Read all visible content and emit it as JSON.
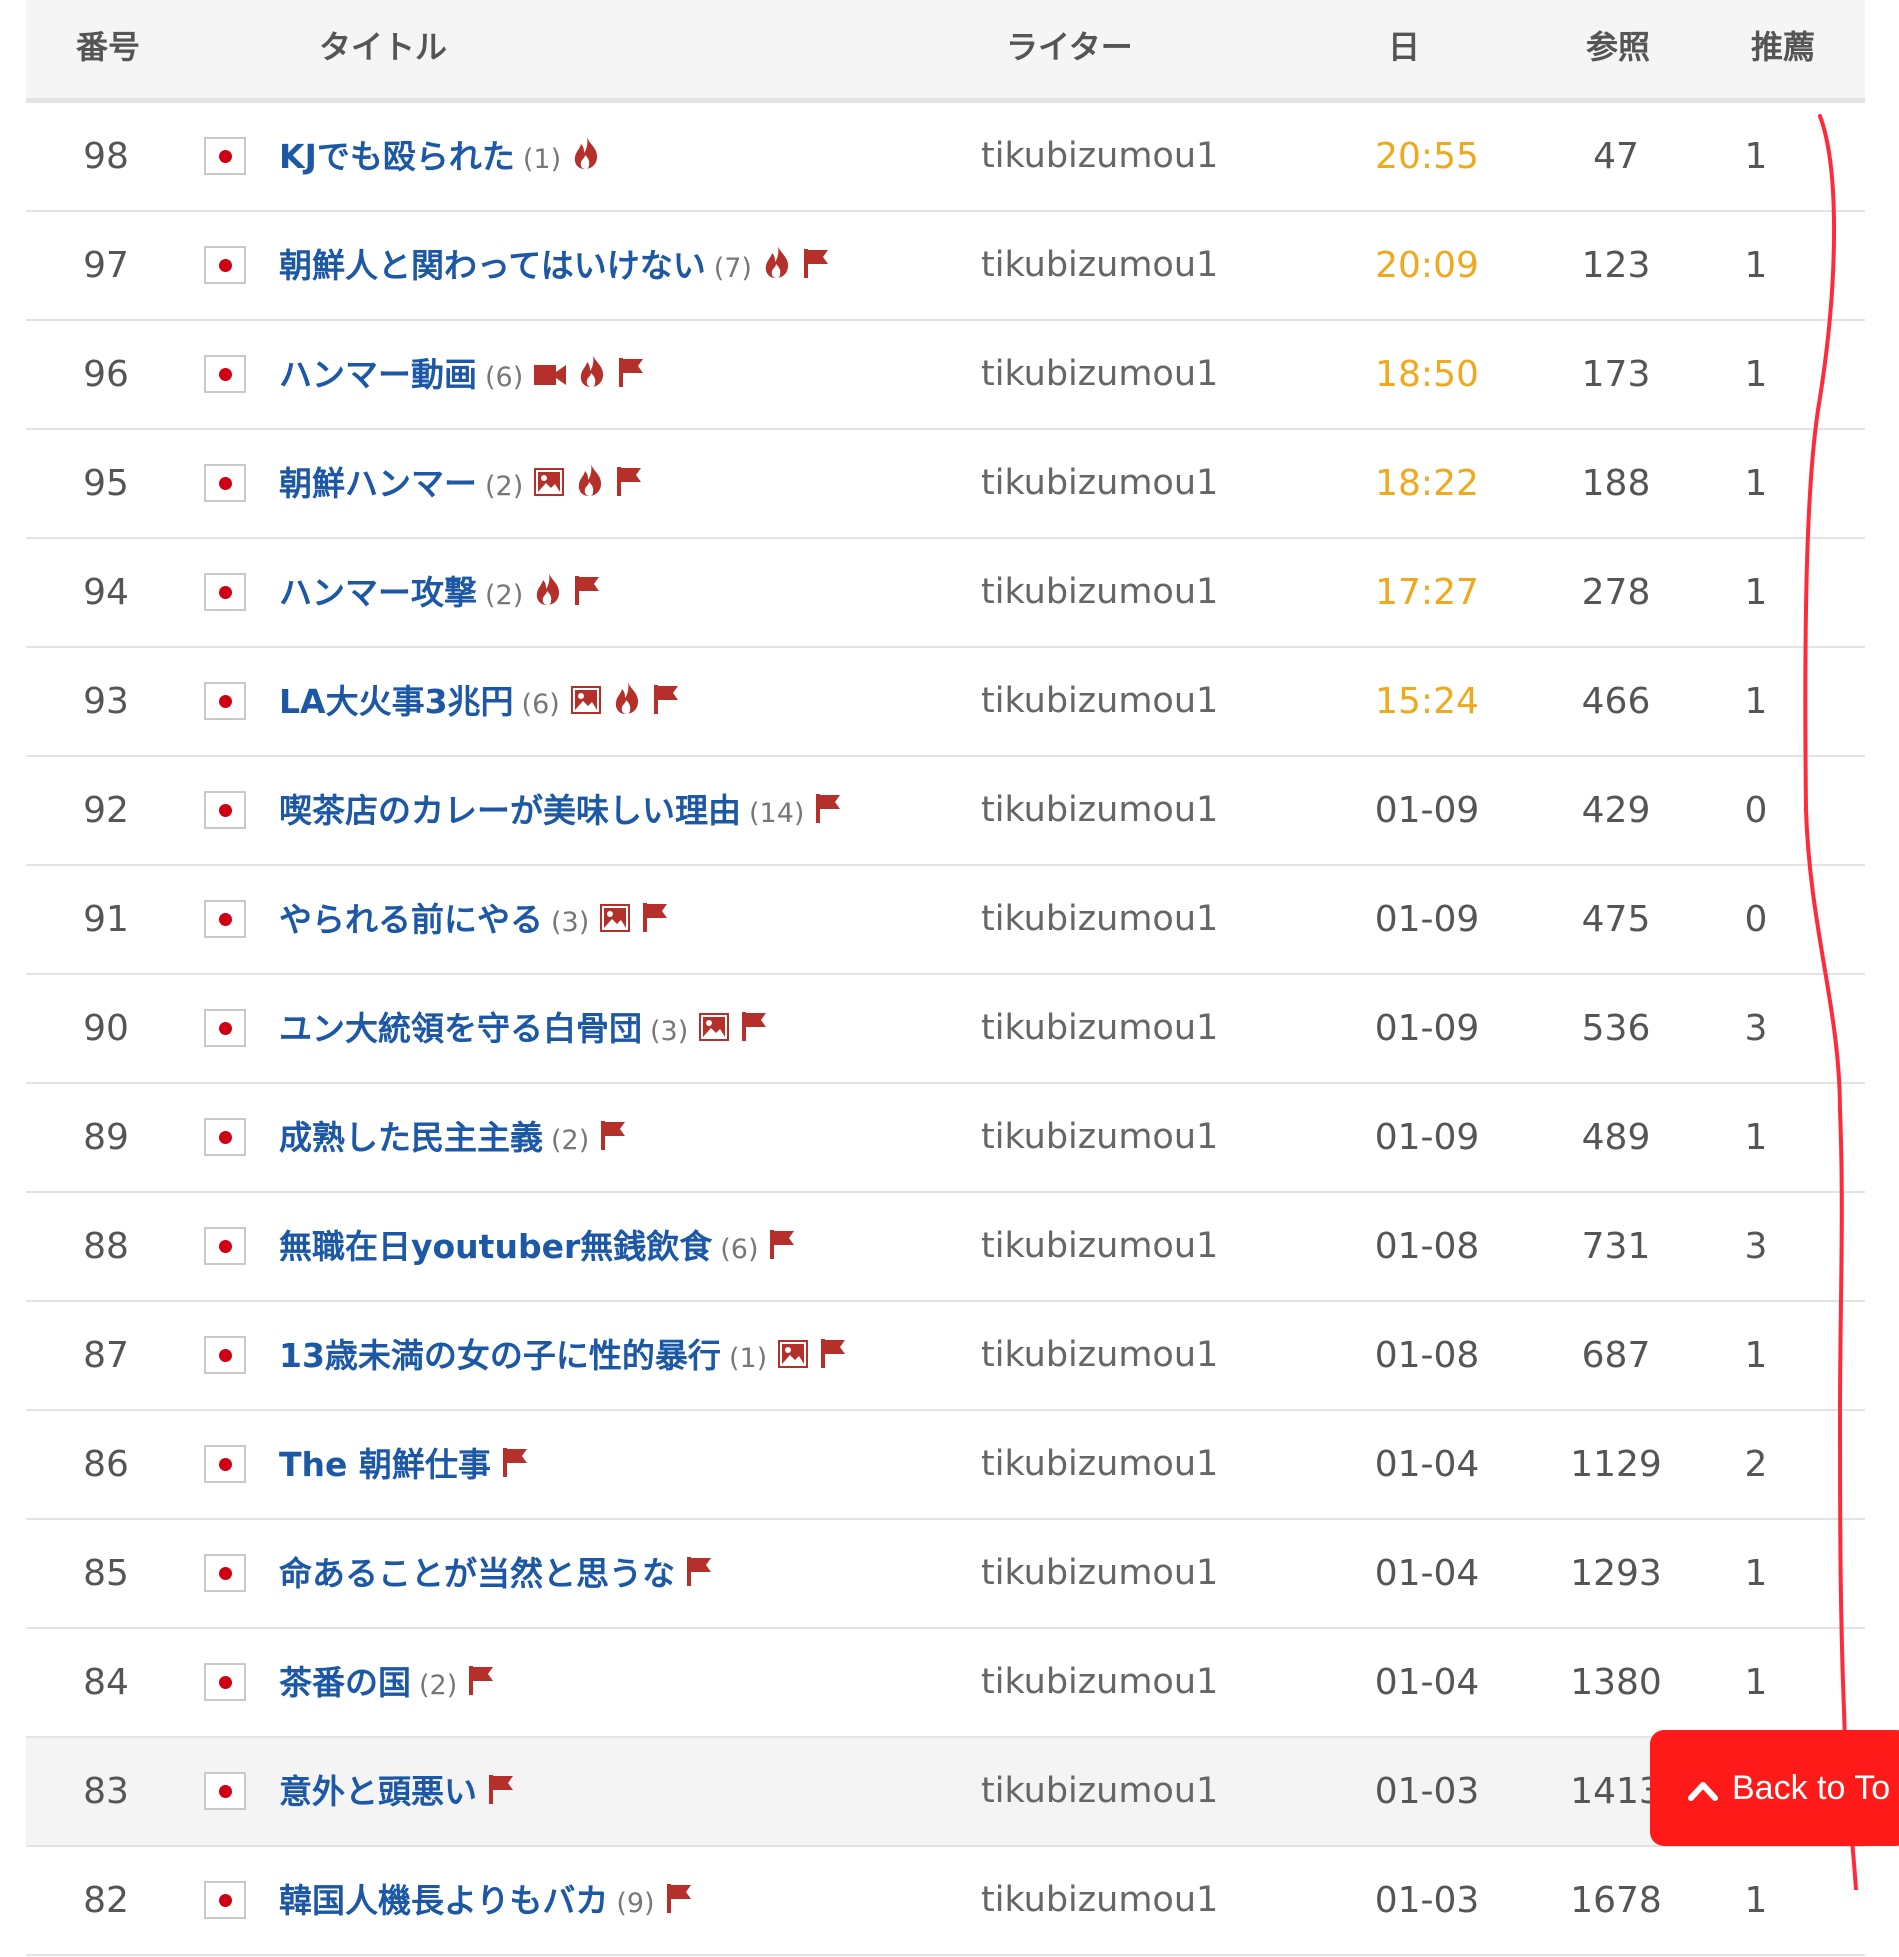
{
  "header": {
    "num": "番号",
    "title": "タイトル",
    "writer": "ライター",
    "date": "日",
    "views": "参照",
    "recommend": "推薦"
  },
  "rows": [
    {
      "num": "98",
      "title": "KJでも殴られた",
      "count": "(1)",
      "icons": [
        "fire"
      ],
      "writer": "tikubizumou1",
      "date": "20:55",
      "today": true,
      "views": "47",
      "rec": "1"
    },
    {
      "num": "97",
      "title": "朝鮮人と関わってはいけない",
      "count": "(7)",
      "icons": [
        "fire",
        "flag"
      ],
      "writer": "tikubizumou1",
      "date": "20:09",
      "today": true,
      "views": "123",
      "rec": "1"
    },
    {
      "num": "96",
      "title": "ハンマー動画",
      "count": "(6)",
      "icons": [
        "video",
        "fire",
        "flag"
      ],
      "writer": "tikubizumou1",
      "date": "18:50",
      "today": true,
      "views": "173",
      "rec": "1"
    },
    {
      "num": "95",
      "title": "朝鮮ハンマー",
      "count": "(2)",
      "icons": [
        "image",
        "fire",
        "flag"
      ],
      "writer": "tikubizumou1",
      "date": "18:22",
      "today": true,
      "views": "188",
      "rec": "1"
    },
    {
      "num": "94",
      "title": "ハンマー攻撃",
      "count": "(2)",
      "icons": [
        "fire",
        "flag"
      ],
      "writer": "tikubizumou1",
      "date": "17:27",
      "today": true,
      "views": "278",
      "rec": "1"
    },
    {
      "num": "93",
      "title": "LA大火事3兆円",
      "count": "(6)",
      "icons": [
        "image",
        "fire",
        "flag"
      ],
      "writer": "tikubizumou1",
      "date": "15:24",
      "today": true,
      "views": "466",
      "rec": "1"
    },
    {
      "num": "92",
      "title": "喫茶店のカレーが美味しい理由",
      "count": "(14)",
      "icons": [
        "flag"
      ],
      "writer": "tikubizumou1",
      "date": "01-09",
      "today": false,
      "views": "429",
      "rec": "0"
    },
    {
      "num": "91",
      "title": "やられる前にやる",
      "count": "(3)",
      "icons": [
        "image",
        "flag"
      ],
      "writer": "tikubizumou1",
      "date": "01-09",
      "today": false,
      "views": "475",
      "rec": "0"
    },
    {
      "num": "90",
      "title": "ユン大統領を守る白骨団",
      "count": "(3)",
      "icons": [
        "image",
        "flag"
      ],
      "writer": "tikubizumou1",
      "date": "01-09",
      "today": false,
      "views": "536",
      "rec": "3"
    },
    {
      "num": "89",
      "title": "成熟した民主主義",
      "count": "(2)",
      "icons": [
        "flag"
      ],
      "writer": "tikubizumou1",
      "date": "01-09",
      "today": false,
      "views": "489",
      "rec": "1"
    },
    {
      "num": "88",
      "title": "無職在日youtuber無銭飲食",
      "count": "(6)",
      "icons": [
        "flag"
      ],
      "writer": "tikubizumou1",
      "date": "01-08",
      "today": false,
      "views": "731",
      "rec": "3"
    },
    {
      "num": "87",
      "title": "13歳未満の女の子に性的暴行",
      "count": "(1)",
      "icons": [
        "image",
        "flag"
      ],
      "writer": "tikubizumou1",
      "date": "01-08",
      "today": false,
      "views": "687",
      "rec": "1"
    },
    {
      "num": "86",
      "title": "The 朝鮮仕事",
      "count": "",
      "icons": [
        "flag"
      ],
      "writer": "tikubizumou1",
      "date": "01-04",
      "today": false,
      "views": "1129",
      "rec": "2"
    },
    {
      "num": "85",
      "title": "命あることが当然と思うな",
      "count": "",
      "icons": [
        "flag"
      ],
      "writer": "tikubizumou1",
      "date": "01-04",
      "today": false,
      "views": "1293",
      "rec": "1"
    },
    {
      "num": "84",
      "title": "茶番の国",
      "count": "(2)",
      "icons": [
        "flag"
      ],
      "writer": "tikubizumou1",
      "date": "01-04",
      "today": false,
      "views": "1380",
      "rec": "1"
    },
    {
      "num": "83",
      "title": "意外と頭悪い",
      "count": "",
      "icons": [
        "flag"
      ],
      "writer": "tikubizumou1",
      "date": "01-03",
      "today": false,
      "views": "1413",
      "rec": "",
      "highlight": true
    },
    {
      "num": "82",
      "title": "韓国人機長よりもバカ",
      "count": "(9)",
      "icons": [
        "flag"
      ],
      "writer": "tikubizumou1",
      "date": "01-03",
      "today": false,
      "views": "1678",
      "rec": "1"
    }
  ],
  "country_flag_icon": "japan-flag-icon",
  "back_to_top": "Back to To",
  "colors": {
    "title_link": "#1c58a6",
    "today_date": "#f0a81c",
    "icon_red": "#b5302b",
    "back_button": "#ff1a1a",
    "annotation": "#ff2a3a"
  }
}
